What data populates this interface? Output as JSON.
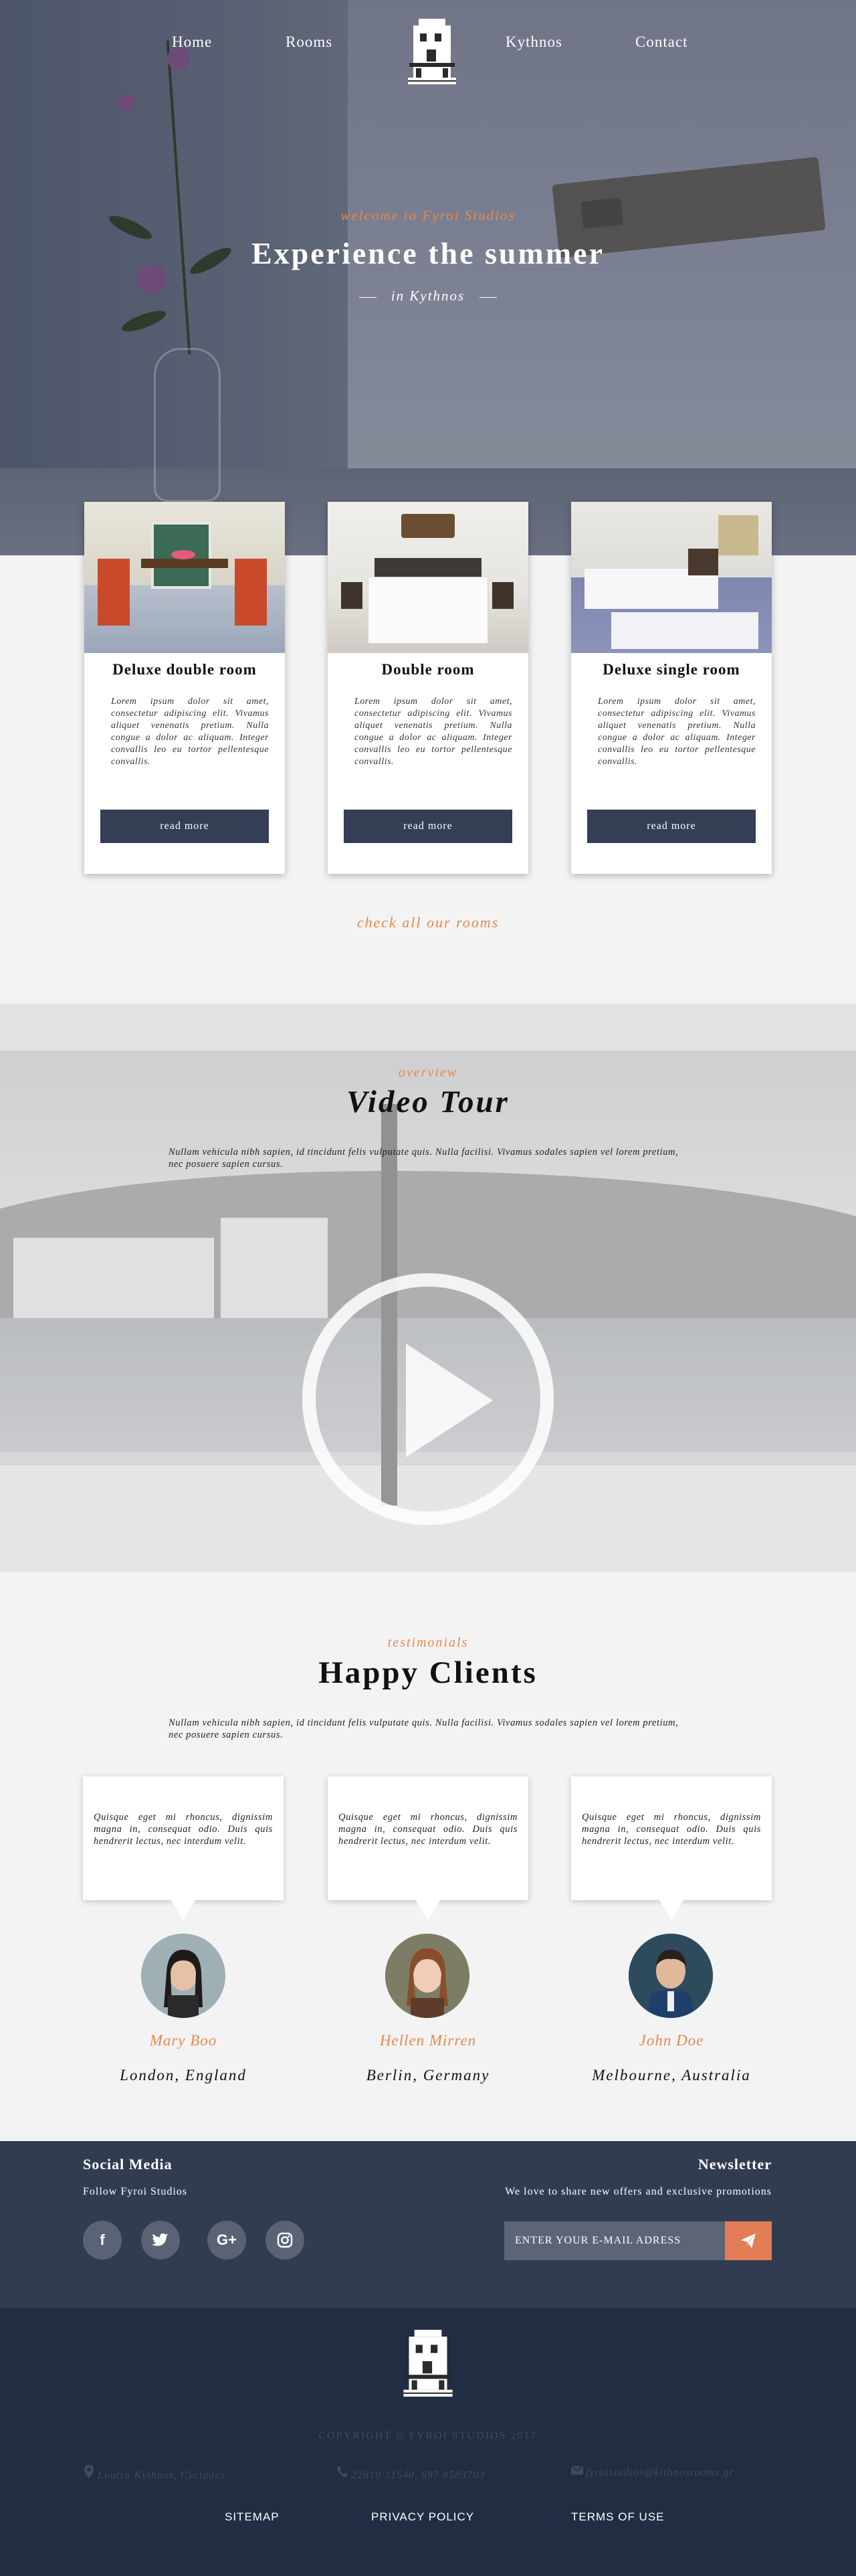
{
  "nav": {
    "home": "Home",
    "rooms": "Rooms",
    "kythnos": "Kythnos",
    "contact": "Contact"
  },
  "hero": {
    "welcome": "welcome to Fyroi Studios",
    "title": "Experience the summer",
    "subtitle": "in Kythnos"
  },
  "rooms": [
    {
      "title": "Deluxe double room",
      "text": "Lorem ipsum dolor sit amet, consectetur adipiscing elit. Vivamus aliquet venenatis pretium. Nulla congue a dolor ac aliquam. Integer convallis leo eu tortor pellentesque convallis.",
      "button": "read more"
    },
    {
      "title": "Double room",
      "text": "Lorem ipsum dolor sit amet, consectetur adipiscing elit. Vivamus aliquet venenatis pretium. Nulla congue a dolor ac aliquam. Integer convallis leo eu tortor pellentesque convallis.",
      "button": "read more"
    },
    {
      "title": "Deluxe single room",
      "text": "Lorem ipsum dolor sit amet, consectetur adipiscing elit. Vivamus aliquet venenatis pretium. Nulla congue a dolor ac aliquam. Integer convallis leo eu tortor pellentesque convallis.",
      "button": "read more"
    }
  ],
  "check_rooms": "check all our rooms",
  "video": {
    "label": "overview",
    "title": "Video Tour",
    "text": "Nullam vehicula nibh sapien, id tincidunt felis vulputate quis. Nulla facilisi. Vivamus sodales sapien vel lorem pretium, nec posuere sapien cursus."
  },
  "testimonials": {
    "label": "testimonials",
    "title": "Happy Clients",
    "text": "Nullam vehicula nibh sapien, id tincidunt felis vulputate quis. Nulla facilisi. Vivamus sodales sapien vel lorem pretium, nec posuere sapien cursus.",
    "clients": [
      {
        "quote": "Quisque eget mi rhoncus, dignissim magna in, consequat odio. Duis quis hendrerit lectus, nec interdum velit.",
        "name": "Mary Boo",
        "location": "London, England"
      },
      {
        "quote": "Quisque eget mi rhoncus, dignissim magna in, consequat odio. Duis quis hendrerit lectus, nec interdum velit.",
        "name": "Hellen Mirren",
        "location": "Berlin, Germany"
      },
      {
        "quote": "Quisque eget mi rhoncus, dignissim magna in, consequat odio. Duis quis hendrerit lectus, nec interdum velit.",
        "name": "John Doe",
        "location": "Melbourne, Australia"
      }
    ]
  },
  "footer": {
    "social_title": "Social Media",
    "social_sub": "Follow Fyroi Studios",
    "social_icons": [
      "facebook-icon",
      "twitter-icon",
      "google-plus-icon",
      "instagram-icon"
    ],
    "social_glyphs": [
      "f",
      "",
      "G+",
      ""
    ],
    "newsletter_title": "Newsletter",
    "newsletter_sub": "We love to share new offers and exclusive promotions",
    "email_placeholder": "ENTER YOUR E-MAIL ADRESS",
    "copyright": "COPYRIGHT © FYROI STUDIOS 2017",
    "address": "Loutra Kythnos, Cyclades",
    "phone": "22810 31540, 697 8583703",
    "email": "fyroistudios@kithnosrooms.gr",
    "links": {
      "sitemap": "SITEMAP",
      "privacy": "PRIVACY POLICY",
      "terms": "TERMS OF USE"
    }
  },
  "colors": {
    "accent": "#e8874a",
    "button": "#343e54",
    "footer_top": "#323c51",
    "footer_bottom": "#222d44",
    "send": "#e27d55"
  }
}
